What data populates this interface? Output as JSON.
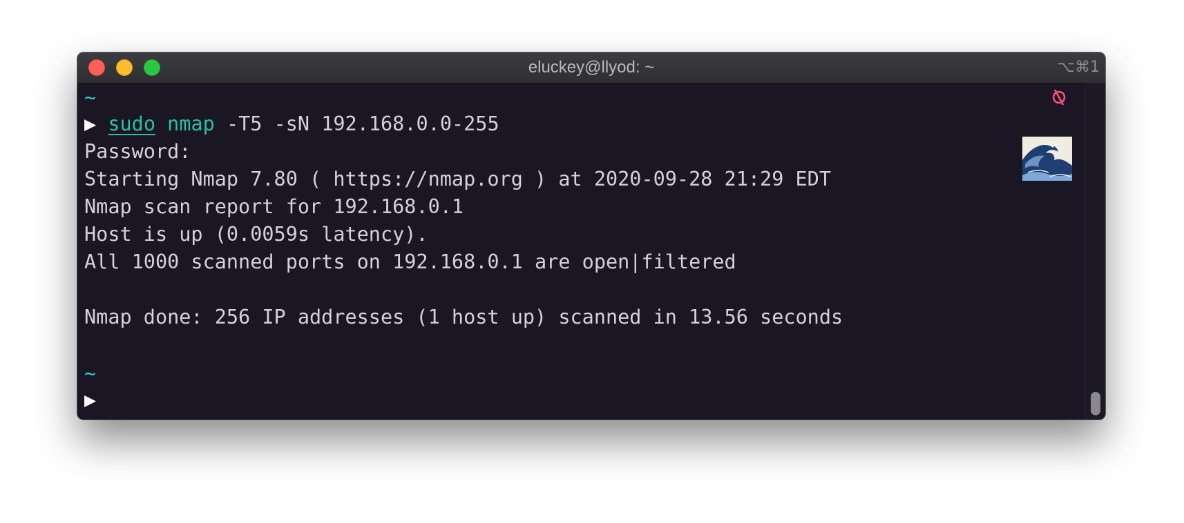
{
  "window": {
    "title": "eluckey@llyod: ~",
    "shortcut": "⌥⌘1"
  },
  "terminal": {
    "prompt_dir_1": "~",
    "prompt_symbol_1": "▶",
    "command": {
      "sudo": "sudo",
      "nmap": "nmap",
      "args": "-T5 -sN 192.168.0.0-255"
    },
    "output": [
      "Password:",
      "Starting Nmap 7.80 ( https://nmap.org ) at 2020-09-28 21:29 EDT",
      "Nmap scan report for 192.168.0.1",
      "Host is up (0.0059s latency).",
      "All 1000 scanned ports on 192.168.0.1 are open|filtered",
      "",
      "Nmap done: 256 IP addresses (1 host up) scanned in 13.56 seconds"
    ],
    "prompt_dir_2": "~",
    "prompt_symbol_2": "▶"
  },
  "colors": {
    "background": "#1a1623",
    "text": "#d5d1dc",
    "tilde": "#31d0d0",
    "command": "#28c0a6",
    "status_icon": "#ff4f7b"
  },
  "icons": {
    "status": "no-git-icon",
    "emoji": "wave-emoji-icon"
  }
}
